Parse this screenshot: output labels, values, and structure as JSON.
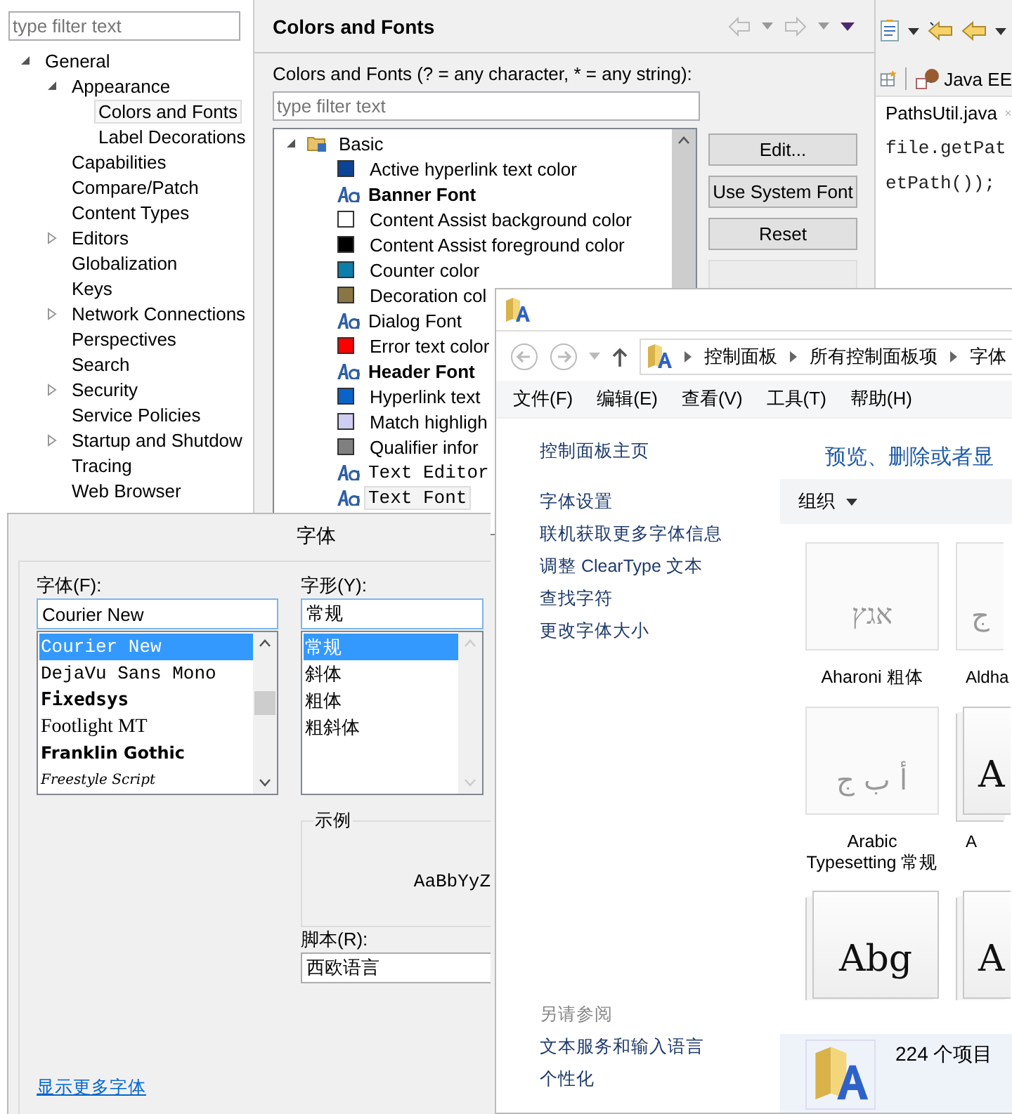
{
  "preferences": {
    "filter_placeholder": "type filter text",
    "tree": [
      {
        "label": "General",
        "expanded": true,
        "selected": false,
        "children": [
          {
            "label": "Appearance",
            "expanded": true,
            "selected": false,
            "children": [
              {
                "label": "Colors and Fonts",
                "selected": true
              },
              {
                "label": "Label Decorations",
                "selected": false
              }
            ]
          },
          {
            "label": "Capabilities",
            "selected": false
          },
          {
            "label": "Compare/Patch",
            "selected": false
          },
          {
            "label": "Content Types",
            "selected": false
          },
          {
            "label": "Editors",
            "expanded": false,
            "selected": false
          },
          {
            "label": "Globalization",
            "selected": false
          },
          {
            "label": "Keys",
            "selected": false
          },
          {
            "label": "Network Connections",
            "expanded": false,
            "selected": false
          },
          {
            "label": "Perspectives",
            "selected": false
          },
          {
            "label": "Search",
            "selected": false
          },
          {
            "label": "Security",
            "expanded": false,
            "selected": false
          },
          {
            "label": "Service Policies",
            "selected": false
          },
          {
            "label": "Startup and Shutdow",
            "expanded": false,
            "selected": false
          },
          {
            "label": "Tracing",
            "selected": false
          },
          {
            "label": "Web Browser",
            "selected": false
          }
        ]
      }
    ],
    "page_title": "Colors and Fonts",
    "filter_label": "Colors and Fonts (? = any character, * = any string):",
    "page_filter_placeholder": "type filter text",
    "color_tree": [
      {
        "label": "Basic",
        "expanded": true,
        "selected": false,
        "children": [
          {
            "kind": "color",
            "label": "Active hyperlink text color",
            "color": "#0b4496",
            "selected": false
          },
          {
            "kind": "bold-font",
            "label": "Banner Font",
            "selected": false
          },
          {
            "kind": "color",
            "label": "Content Assist background color",
            "color": "#ffffff",
            "selected": false
          },
          {
            "kind": "color",
            "label": "Content Assist foreground color",
            "color": "#000000",
            "selected": false
          },
          {
            "kind": "color",
            "label": "Counter color",
            "color": "#0b7eab",
            "selected": false
          },
          {
            "kind": "color",
            "label": "Decoration col",
            "color": "#8a7645",
            "selected": false
          },
          {
            "kind": "font",
            "label": "Dialog Font",
            "selected": false
          },
          {
            "kind": "color",
            "label": "Error text color",
            "color": "#ff0000",
            "selected": false
          },
          {
            "kind": "bold-font",
            "label": "Header Font",
            "selected": false
          },
          {
            "kind": "color",
            "label": "Hyperlink text",
            "color": "#0a63c9",
            "selected": false
          },
          {
            "kind": "color",
            "label": "Match highligh",
            "color": "#d0cdf2",
            "selected": false
          },
          {
            "kind": "color",
            "label": "Qualifier infor",
            "color": "#808080",
            "selected": false
          },
          {
            "kind": "mono-font",
            "label": "Text Editor",
            "selected": false
          },
          {
            "kind": "mono-font",
            "label": "Text Font",
            "selected": true
          }
        ]
      }
    ],
    "buttons": [
      {
        "label": "Edit...",
        "disabled": false
      },
      {
        "label": "Use System Font",
        "disabled": false
      },
      {
        "label": "Reset",
        "disabled": false
      }
    ]
  },
  "ide": {
    "perspective": "Java EE",
    "editor_tab": "PathsUtil.java",
    "code_lines": [
      "file.getPat",
      "etPath());"
    ]
  },
  "explorer": {
    "breadcrumbs": [
      "控制面板",
      "所有控制面板项",
      "字体"
    ],
    "menu": [
      "文件(F)",
      "编辑(E)",
      "查看(V)",
      "工具(T)",
      "帮助(H)"
    ],
    "home_link": "控制面板主页",
    "task_links": [
      "字体设置",
      "联机获取更多字体信息",
      "调整 ClearType 文本",
      "查找字符",
      "更改字体大小"
    ],
    "see_also_heading": "另请参阅",
    "see_also_links": [
      "文本服务和输入语言",
      "个性化"
    ],
    "heading": "预览、删除或者显",
    "organize": "组织",
    "fonts": [
      {
        "label": "Aharoni 粗体",
        "sample": "אגץ",
        "stacked": false
      },
      {
        "label": "Aldha",
        "sample": "ج",
        "stacked": false
      },
      {
        "label": "Arabic Typesetting 常规",
        "sample": "أ ب ج",
        "stacked": false
      },
      {
        "label": "A",
        "sample": "A",
        "stacked": true
      },
      {
        "sample": "Abg",
        "stacked": true
      },
      {
        "sample": "A",
        "stacked": true
      }
    ],
    "status": "224 个项目"
  },
  "font_dialog": {
    "title": "字体",
    "font_label": "字体(F):",
    "font_value": "Courier New",
    "fonts": [
      {
        "kind": "mono",
        "label": "Courier New",
        "selected": true
      },
      {
        "kind": "mono",
        "label": "DejaVu Sans Mono",
        "selected": false
      },
      {
        "kind": "bold-mono",
        "label": "Fixedsys",
        "selected": false
      },
      {
        "kind": "serif",
        "label": "Footlight MT",
        "selected": false
      },
      {
        "kind": "bold-sans",
        "label": "Franklin Gothic",
        "selected": false
      },
      {
        "kind": "script",
        "label": "Freestyle Script",
        "selected": false
      }
    ],
    "style_label": "字形(Y):",
    "style_value": "常规",
    "styles": [
      {
        "label": "常规",
        "selected": true
      },
      {
        "label": "斜体",
        "selected": false
      },
      {
        "label": "粗体",
        "selected": false
      },
      {
        "label": "粗斜体",
        "selected": false
      }
    ],
    "sample_legend": "示例",
    "sample_text": "AaBbYyZ",
    "script_label": "脚本(R):",
    "script_value": "西欧语言",
    "more_fonts_link": "显示更多字体"
  }
}
